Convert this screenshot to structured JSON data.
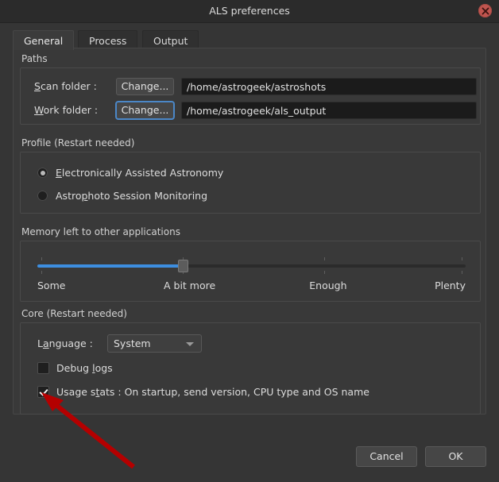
{
  "window": {
    "title": "ALS preferences",
    "close_icon": "close-circle-icon"
  },
  "tabs": [
    {
      "label": "General",
      "active": true
    },
    {
      "label": "Process",
      "active": false
    },
    {
      "label": "Output",
      "active": false
    }
  ],
  "paths": {
    "group_label": "Paths",
    "rows": [
      {
        "label": "Scan folder :",
        "mnemonic": "S",
        "button_label": "Change...",
        "value": "/home/astrogeek/astroshots",
        "focused": false
      },
      {
        "label": "Work folder :",
        "mnemonic": "W",
        "button_label": "Change...",
        "value": "/home/astrogeek/als_output",
        "focused": true
      }
    ]
  },
  "profile": {
    "group_label": "Profile (Restart needed)",
    "options": [
      {
        "label": "Electronically Assisted Astronomy",
        "mnemonic": "E",
        "selected": true
      },
      {
        "label": "Astrophoto Session Monitoring",
        "mnemonic": "p",
        "selected": false
      }
    ]
  },
  "memory": {
    "group_label": "Memory left to other applications",
    "slider": {
      "value": 1,
      "min": 0,
      "max": 3,
      "fill_percent": 34,
      "accent_color": "#3d8ee0"
    },
    "labels": [
      "Some",
      "A bit more",
      "Enough",
      "Plenty"
    ]
  },
  "core": {
    "group_label": "Core (Restart needed)",
    "language": {
      "label": "Language :",
      "mnemonic": "a",
      "value": "System",
      "arrow_icon": "chevron-down-icon"
    },
    "checkboxes": [
      {
        "label": "Debug logs",
        "mnemonic": "l",
        "checked": false
      },
      {
        "label": "Usage stats : On startup, send version, CPU type and OS name",
        "mnemonic": "t",
        "checked": true
      }
    ]
  },
  "footer": {
    "cancel_label": "Cancel",
    "ok_label": "OK"
  },
  "annotation": {
    "arrow_color": "#b40000",
    "points_to": "usage-stats-checkbox"
  }
}
